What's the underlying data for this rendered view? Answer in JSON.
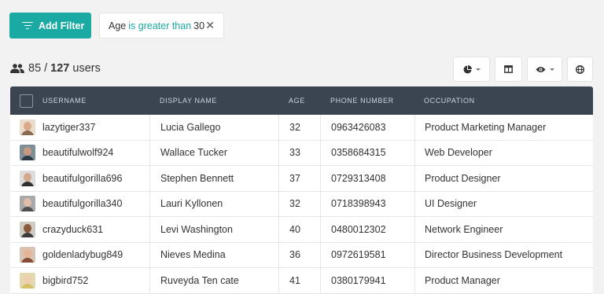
{
  "toolbar": {
    "add_filter_label": "Add Filter",
    "filter": {
      "field": "Age",
      "operator": "is greater than",
      "value": "30"
    },
    "buttons": [
      {
        "name": "chart-view-button",
        "icon": "pie-chart-icon",
        "has_caret": true
      },
      {
        "name": "column-layout-button",
        "icon": "columns-icon",
        "has_caret": false
      },
      {
        "name": "visibility-button",
        "icon": "eye-icon",
        "has_caret": true
      },
      {
        "name": "globe-button",
        "icon": "globe-icon",
        "has_caret": false
      }
    ]
  },
  "summary": {
    "shown": "85",
    "separator": "/",
    "total": "127",
    "unit": "users"
  },
  "table": {
    "columns": [
      "USERNAME",
      "DISPLAY NAME",
      "AGE",
      "PHONE NUMBER",
      "OCCUPATION"
    ],
    "rows": [
      {
        "username": "lazytiger337",
        "display_name": "Lucia Gallego",
        "age": "32",
        "phone": "0963426083",
        "occupation": "Product Marketing Manager",
        "avatar": {
          "bg": "#e9dccb",
          "skin": "#d9a98a",
          "shirt": "#8a6a52"
        }
      },
      {
        "username": "beautifulwolf924",
        "display_name": "Wallace Tucker",
        "age": "33",
        "phone": "0358684315",
        "occupation": "Web Developer",
        "avatar": {
          "bg": "#7f8f9a",
          "skin": "#c79a7f",
          "shirt": "#2f3a44"
        }
      },
      {
        "username": "beautifulgorilla696",
        "display_name": "Stephen Bennett",
        "age": "37",
        "phone": "0729313408",
        "occupation": "Product Designer",
        "avatar": {
          "bg": "#dcdcdc",
          "skin": "#d4a88c",
          "shirt": "#303030"
        }
      },
      {
        "username": "beautifulgorilla340",
        "display_name": "Lauri Kyllonen",
        "age": "32",
        "phone": "0718398943",
        "occupation": "UI Designer",
        "avatar": {
          "bg": "#a9a9a9",
          "skin": "#e0bfa8",
          "shirt": "#505050"
        }
      },
      {
        "username": "crazyduck631",
        "display_name": "Levi Washington",
        "age": "40",
        "phone": "0480012302",
        "occupation": "Network Engineer",
        "avatar": {
          "bg": "#cfcac2",
          "skin": "#8b5a3c",
          "shirt": "#3b3b3b"
        }
      },
      {
        "username": "goldenladybug849",
        "display_name": "Nieves Medina",
        "age": "36",
        "phone": "0972619581",
        "occupation": "Director Business Development",
        "avatar": {
          "bg": "#d8c4b4",
          "skin": "#e4b494",
          "shirt": "#8a4b36"
        }
      },
      {
        "username": "bigbird752",
        "display_name": "Ruveyda Ten cate",
        "age": "41",
        "phone": "0380179941",
        "occupation": "Product Manager",
        "avatar": {
          "bg": "#e3d9b0",
          "skin": "#f0cfae",
          "shirt": "#d8c069"
        }
      }
    ]
  },
  "colors": {
    "accent": "#1aa9a3",
    "header_bg": "#3b4552",
    "page_bg": "#f2f2f2"
  }
}
